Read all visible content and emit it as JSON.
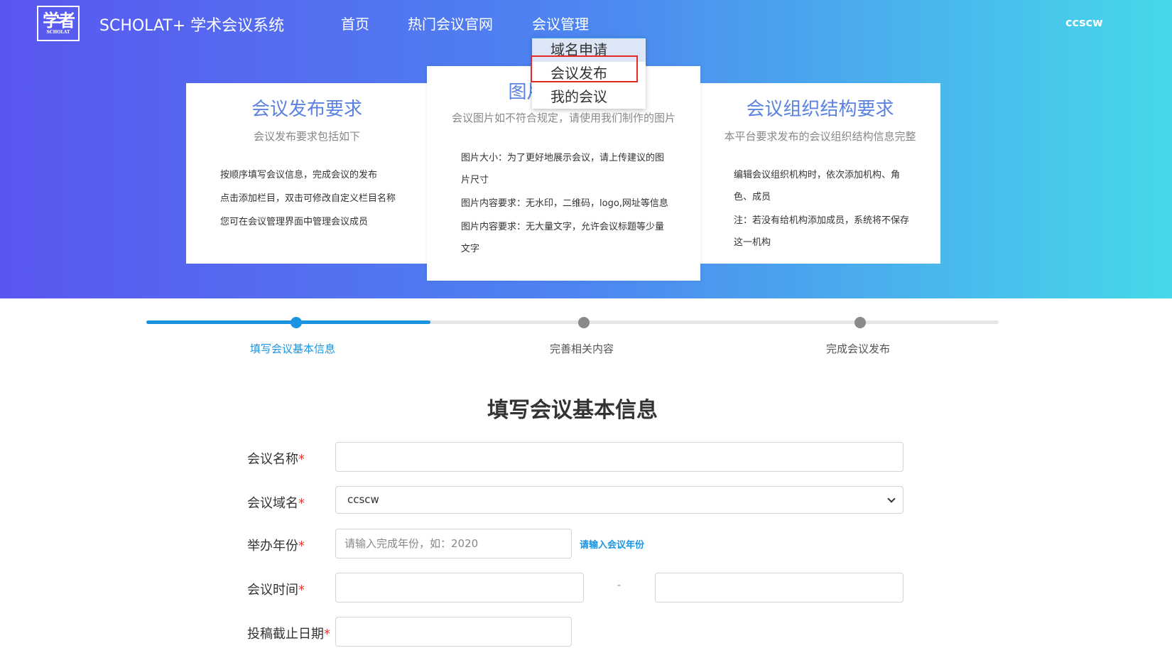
{
  "header": {
    "site_title": "SCHOLAT+ 学术会议系统",
    "logo_text": "学者",
    "logo_sub": "SCHOLAT",
    "nav": {
      "home": "首页",
      "hot": "热门会议官网",
      "manage": "会议管理"
    },
    "user": "ccscw",
    "dropdown": [
      "域名申请",
      "会议发布",
      "我的会议"
    ]
  },
  "cards": {
    "left": {
      "title": "会议发布要求",
      "subtitle": "会议发布要求包括如下",
      "lines": [
        "按顺序填写会议信息，完成会议的发布",
        "点击添加栏目，双击可修改自定义栏目名称",
        "您可在会议管理界面中管理会议成员"
      ]
    },
    "middle": {
      "title": "图片格式要求",
      "subtitle": "会议图片如不符合规定，请使用我们制作的图片",
      "lines": [
        "图片大小：为了更好地展示会议，请上传建议的图",
        "片尺寸",
        "图片内容要求：无水印，二维码，logo,网址等信息",
        "图片内容要求：无大量文字，允许会议标题等少量",
        "文字"
      ]
    },
    "right": {
      "title": "会议组织结构要求",
      "subtitle": "本平台要求发布的会议组织结构信息完整",
      "lines": [
        "编辑会议组织机构时，依次添加机构、角",
        "色、成员",
        "注：若没有给机构添加成员，系统将不保存",
        "这一机构"
      ]
    }
  },
  "steps": {
    "progress": 0.333,
    "labels": [
      "填写会议基本信息",
      "完善相关内容",
      "完成会议发布"
    ]
  },
  "form": {
    "title": "填写会议基本信息",
    "required_mark": "*",
    "name_label": "会议名称",
    "domain_label": "会议域名",
    "domain_value": "ccscw",
    "year_label": "举办年份",
    "year_placeholder": "请输入完成年份，如：2020",
    "year_hint": "请输入会议年份",
    "time_label": "会议时间",
    "time_separator": "-",
    "deadline_label": "投稿截止日期"
  },
  "colors": {
    "gradient_start": "#5a56f0",
    "gradient_end": "#46d8ea",
    "accent": "#1a94e0",
    "card_title": "#5b82e0",
    "highlight_box": "#e52a24",
    "required": "#e53935"
  }
}
